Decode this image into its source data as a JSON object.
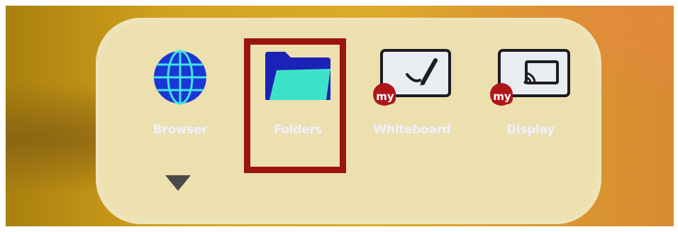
{
  "launcher": {
    "apps": [
      {
        "label": "Browser",
        "icon": "globe-icon"
      },
      {
        "label": "Folders",
        "icon": "folder-icon"
      },
      {
        "label": "Whiteboard",
        "icon": "whiteboard-icon",
        "badge": "my"
      },
      {
        "label": "Display",
        "icon": "screen-cast-icon",
        "badge": "my"
      }
    ],
    "more_icon": "chevron-down-icon",
    "selected_app": "Folders"
  },
  "colors": {
    "highlight_border": "#9b1410",
    "globe": "#1b36d6",
    "globe_lines": "#3fe7e6",
    "folder_back": "#1d22b6",
    "folder_front": "#3de3c9",
    "badge": "#b0151a",
    "label_text": "#f3f0f4"
  }
}
